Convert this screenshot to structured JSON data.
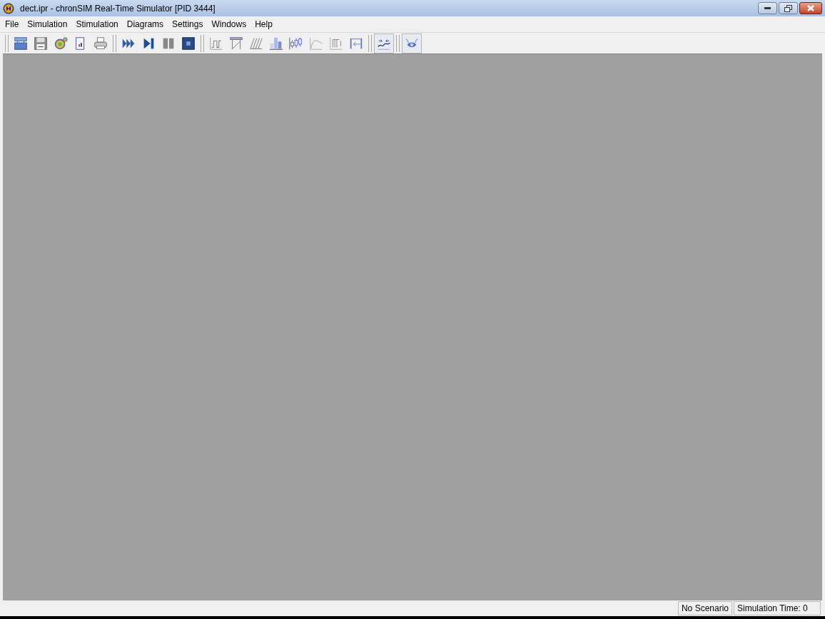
{
  "window": {
    "title": "dect.ipr - chronSIM Real-Time Simulator [PID 3444]"
  },
  "menu": [
    "File",
    "Simulation",
    "Stimulation",
    "Diagrams",
    "Settings",
    "Windows",
    "Help"
  ],
  "toolbar": [
    [
      {
        "kind": "open",
        "pressed": false
      },
      {
        "kind": "save",
        "pressed": false
      },
      {
        "kind": "config",
        "pressed": false
      },
      {
        "kind": "report",
        "pressed": false
      },
      {
        "kind": "print",
        "pressed": false
      }
    ],
    [
      {
        "kind": "run",
        "pressed": false
      },
      {
        "kind": "step",
        "pressed": false
      },
      {
        "kind": "pause",
        "pressed": false
      },
      {
        "kind": "stop",
        "pressed": false
      }
    ],
    [
      {
        "kind": "timing",
        "pressed": false
      },
      {
        "kind": "gantt",
        "pressed": false
      },
      {
        "kind": "hatch",
        "pressed": false
      },
      {
        "kind": "bars",
        "pressed": false
      },
      {
        "kind": "boxplot",
        "pressed": false
      },
      {
        "kind": "curve",
        "pressed": false
      },
      {
        "kind": "comb",
        "pressed": false
      },
      {
        "kind": "arrowback",
        "pressed": false
      }
    ],
    [
      {
        "kind": "wave",
        "pressed": true
      }
    ],
    [
      {
        "kind": "eye",
        "pressed": true
      }
    ]
  ],
  "status_bar": [
    "No Scenario",
    "Simulation Time: 0"
  ]
}
